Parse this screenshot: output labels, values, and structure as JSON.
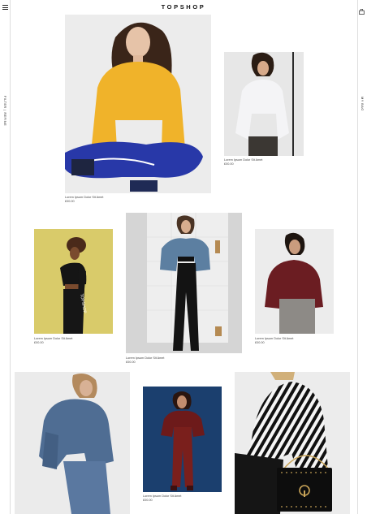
{
  "header": {
    "logo": "TOPSHOP"
  },
  "side": {
    "left_label": "FILTER | REFINE",
    "right_label": "MY BAG"
  },
  "icons": {
    "menu": "menu-icon",
    "bag": "shopping-bag-icon"
  },
  "products": [
    {
      "name": "Lorem Ipsum Dolor Sit Amet",
      "price": "£00.00",
      "photo": "model in yellow sweater and blue joggers"
    },
    {
      "name": "Lorem Ipsum Dolor Sit Amet",
      "price": "£00.00",
      "photo": "model in white oversized sweatshirt"
    },
    {
      "name": "Lorem Ipsum Dolor Sit Amet",
      "price": "£00.00",
      "photo": "model in black crop top and logo joggers"
    },
    {
      "name": "Lorem Ipsum Dolor Sit Amet",
      "price": "£00.00",
      "photo": "model in denim jacket and black flares"
    },
    {
      "name": "Lorem Ipsum Dolor Sit Amet",
      "price": "£00.00",
      "photo": "model in burgundy knit sweater"
    },
    {
      "name": "",
      "price": "",
      "photo": "model in double denim"
    },
    {
      "name": "Lorem Ipsum Dolor Sit Amet",
      "price": "£00.00",
      "photo": "model in burgundy jacket and leggings"
    },
    {
      "name": "",
      "price": "",
      "photo": "model in striped top with black studded bag"
    }
  ]
}
